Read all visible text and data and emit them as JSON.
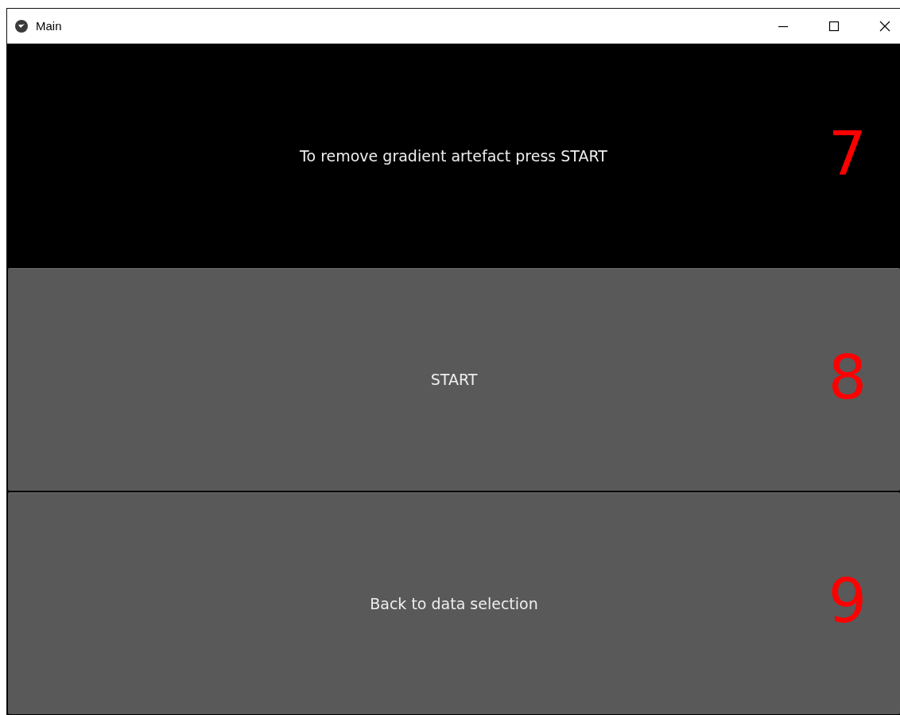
{
  "window": {
    "title": "Main"
  },
  "rows": [
    {
      "kind": "label",
      "text": "To remove gradient artefact press START",
      "annotation": "7"
    },
    {
      "kind": "button",
      "text": "START",
      "annotation": "8"
    },
    {
      "kind": "button",
      "text": "Back to data selection",
      "annotation": "9"
    }
  ]
}
